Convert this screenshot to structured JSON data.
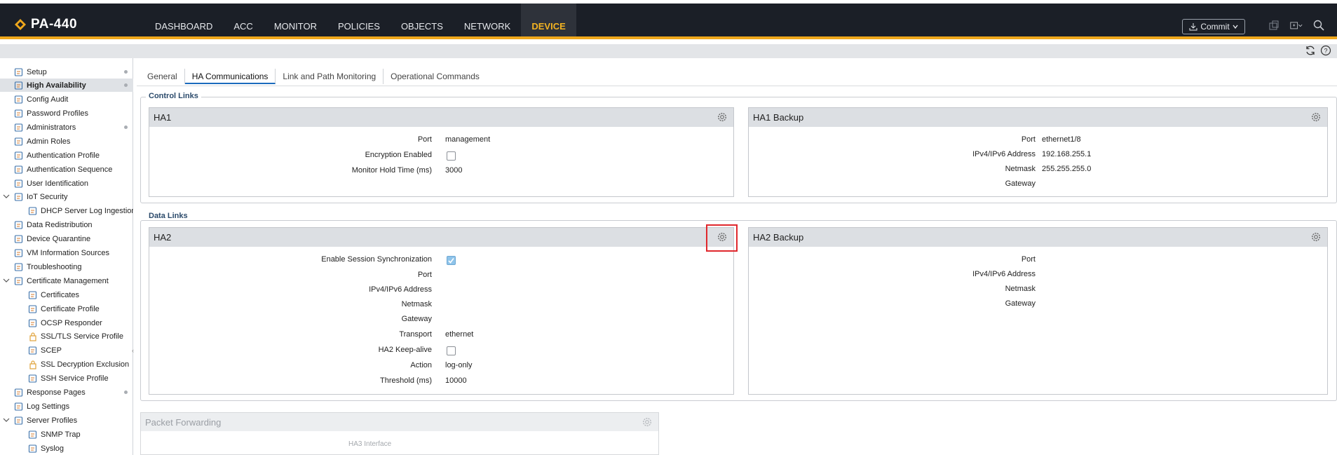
{
  "app": {
    "title": "PA-440"
  },
  "nav": {
    "items": [
      {
        "label": "DASHBOARD"
      },
      {
        "label": "ACC"
      },
      {
        "label": "MONITOR"
      },
      {
        "label": "POLICIES"
      },
      {
        "label": "OBJECTS"
      },
      {
        "label": "NETWORK"
      },
      {
        "label": "DEVICE",
        "active": true
      }
    ]
  },
  "toolbar": {
    "commit_label": "Commit"
  },
  "sidebar": {
    "items": [
      {
        "label": "Setup",
        "icon": "setup-icon",
        "dot": true
      },
      {
        "label": "High Availability",
        "icon": "ha-icon",
        "dot": true,
        "active": true
      },
      {
        "label": "Config Audit",
        "icon": "audit-icon"
      },
      {
        "label": "Password Profiles",
        "icon": "password-icon"
      },
      {
        "label": "Administrators",
        "icon": "admin-icon",
        "dot": true
      },
      {
        "label": "Admin Roles",
        "icon": "roles-icon"
      },
      {
        "label": "Authentication Profile",
        "icon": "auth-profile-icon"
      },
      {
        "label": "Authentication Sequence",
        "icon": "auth-seq-icon"
      },
      {
        "label": "User Identification",
        "icon": "user-id-icon"
      },
      {
        "label": "IoT Security",
        "icon": "iot-icon",
        "expanded": true
      },
      {
        "label": "DHCP Server Log Ingestion",
        "icon": "dhcp-icon",
        "indent": 2
      },
      {
        "label": "Data Redistribution",
        "icon": "redistribution-icon"
      },
      {
        "label": "Device Quarantine",
        "icon": "quarantine-icon"
      },
      {
        "label": "VM Information Sources",
        "icon": "vm-icon"
      },
      {
        "label": "Troubleshooting",
        "icon": "troubleshoot-icon"
      },
      {
        "label": "Certificate Management",
        "icon": "cert-mgmt-icon",
        "expanded": true
      },
      {
        "label": "Certificates",
        "icon": "cert-icon",
        "indent": 2
      },
      {
        "label": "Certificate Profile",
        "icon": "cert-profile-icon",
        "indent": 2
      },
      {
        "label": "OCSP Responder",
        "icon": "ocsp-icon",
        "indent": 2
      },
      {
        "label": "SSL/TLS Service Profile",
        "icon": "lock-icon",
        "indent": 2
      },
      {
        "label": "SCEP",
        "icon": "scep-icon",
        "indent": 2
      },
      {
        "label": "SSL Decryption Exclusion",
        "icon": "lock-icon",
        "indent": 2
      },
      {
        "label": "SSH Service Profile",
        "icon": "ssh-icon",
        "indent": 2
      },
      {
        "label": "Response Pages",
        "icon": "response-icon",
        "dot": true
      },
      {
        "label": "Log Settings",
        "icon": "log-icon"
      },
      {
        "label": "Server Profiles",
        "icon": "server-icon",
        "expanded": true
      },
      {
        "label": "SNMP Trap",
        "icon": "snmp-icon",
        "indent": 2
      },
      {
        "label": "Syslog",
        "icon": "syslog-icon",
        "indent": 2
      }
    ]
  },
  "tabs": [
    {
      "label": "General"
    },
    {
      "label": "HA Communications",
      "active": true
    },
    {
      "label": "Link and Path Monitoring"
    },
    {
      "label": "Operational Commands"
    }
  ],
  "control_links": {
    "legend": "Control Links",
    "ha1": {
      "title": "HA1",
      "port_label": "Port",
      "port": "management",
      "encryption_label": "Encryption Enabled",
      "encryption_enabled": false,
      "hold_label": "Monitor Hold Time (ms)",
      "hold_time": "3000"
    },
    "ha1_backup": {
      "title": "HA1 Backup",
      "port_label": "Port",
      "port": "ethernet1/8",
      "ip_label": "IPv4/IPv6 Address",
      "ip": "192.168.255.1",
      "netmask_label": "Netmask",
      "netmask": "255.255.255.0",
      "gateway_label": "Gateway",
      "gateway": ""
    }
  },
  "data_links": {
    "legend": "Data Links",
    "ha2": {
      "title": "HA2",
      "sync_label": "Enable Session Synchronization",
      "sync_enabled": true,
      "port_label": "Port",
      "port": "",
      "ip_label": "IPv4/IPv6 Address",
      "ip": "",
      "netmask_label": "Netmask",
      "netmask": "",
      "gateway_label": "Gateway",
      "gateway": "",
      "transport_label": "Transport",
      "transport": "ethernet",
      "keepalive_label": "HA2 Keep-alive",
      "keepalive_enabled": false,
      "action_label": "Action",
      "action": "log-only",
      "threshold_label": "Threshold (ms)",
      "threshold": "10000"
    },
    "ha2_backup": {
      "title": "HA2 Backup",
      "port_label": "Port",
      "port": "",
      "ip_label": "IPv4/IPv6 Address",
      "ip": "",
      "netmask_label": "Netmask",
      "netmask": "",
      "gateway_label": "Gateway",
      "gateway": ""
    }
  },
  "packet_forwarding": {
    "title": "Packet Forwarding",
    "ha3_label": "HA3 Interface"
  },
  "colors": {
    "accent": "#f0a81c",
    "topbar": "#1b1f27",
    "active_nav": "#f3b321",
    "highlight": "#e0282d"
  }
}
